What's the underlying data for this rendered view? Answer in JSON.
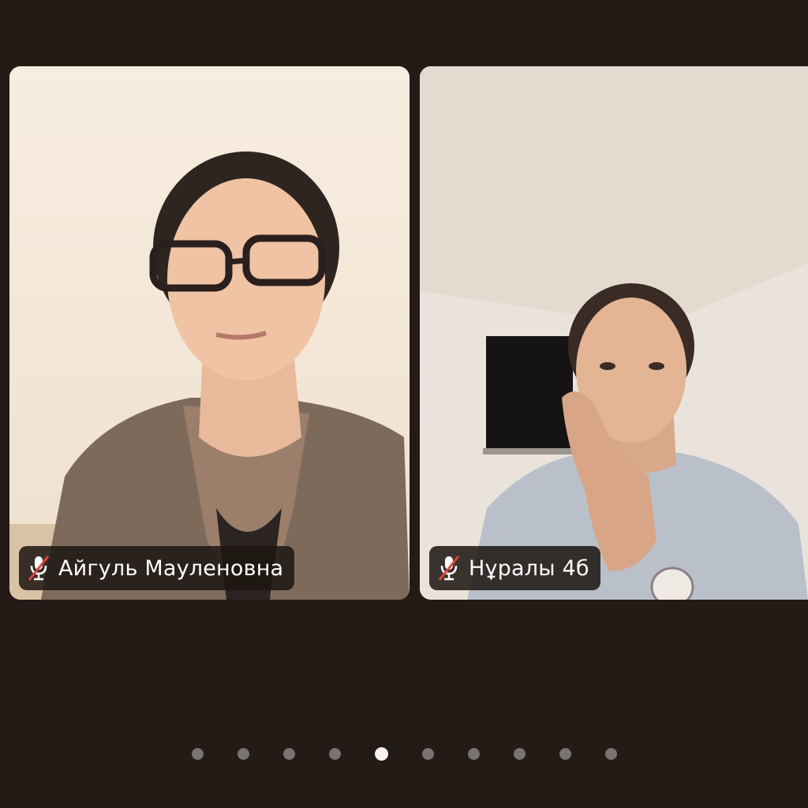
{
  "participants": [
    {
      "name": "Айгуль Мауленовна",
      "mic_state": "muted",
      "icon": "mic-muted-icon"
    },
    {
      "name": "Нұралы 4б",
      "mic_state": "muted",
      "icon": "mic-muted-icon"
    }
  ],
  "pagination": {
    "total_pages": 10,
    "current_page": 5
  },
  "colors": {
    "background": "#241b16",
    "label_background": "#1c1612",
    "label_text": "#ffffff",
    "dot_inactive": "#7a7470",
    "dot_active": "#f4f1ee",
    "mute_slash": "#e0433a"
  }
}
